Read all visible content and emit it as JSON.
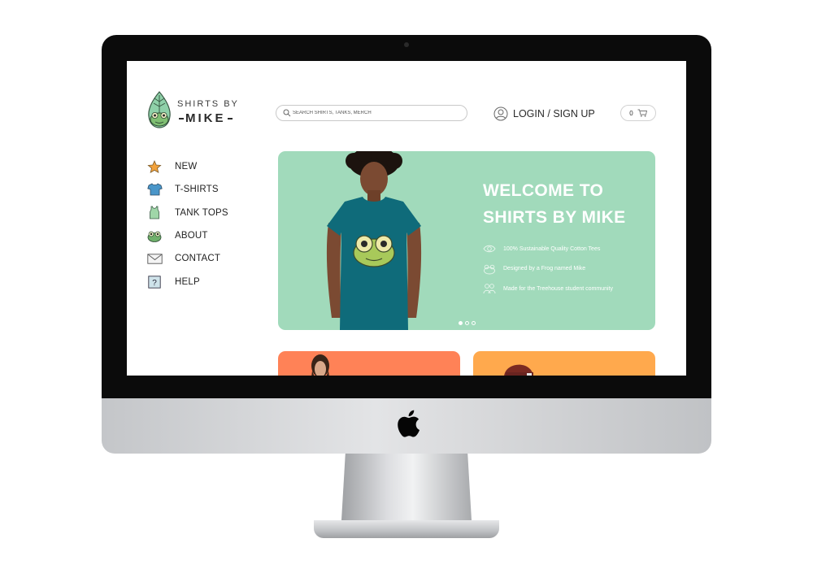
{
  "brand": {
    "line1": "SHIRTS BY",
    "line2": "MIKE"
  },
  "search": {
    "placeholder": "SEARCH SHIRTS, TANKS, MERCH",
    "value": ""
  },
  "account": {
    "login_label": "LOGIN / SIGN UP"
  },
  "cart": {
    "count": "0"
  },
  "sidebar": {
    "items": [
      {
        "label": "NEW",
        "icon": "star-icon"
      },
      {
        "label": "T-SHIRTS",
        "icon": "tshirt-icon"
      },
      {
        "label": "TANK TOPS",
        "icon": "tank-top-icon"
      },
      {
        "label": "ABOUT",
        "icon": "frog-icon"
      },
      {
        "label": "CONTACT",
        "icon": "envelope-icon"
      },
      {
        "label": "HELP",
        "icon": "help-icon"
      }
    ]
  },
  "hero": {
    "title": "WELCOME TO SHIRTS BY MIKE",
    "features": [
      {
        "text": "100% Sustainable Quality Cotton Tees",
        "icon": "eye-icon"
      },
      {
        "text": "Designed by a Frog named Mike",
        "icon": "frog-face-icon"
      },
      {
        "text": "Made for the Treehouse student community",
        "icon": "people-icon"
      }
    ],
    "carousel": {
      "slides": 3,
      "active": 1
    }
  },
  "colors": {
    "hero_bg": "#a1dabb",
    "card_orange_red": "#ff8257",
    "card_orange": "#ffa94d",
    "shirt_teal": "#0f6b7a"
  }
}
